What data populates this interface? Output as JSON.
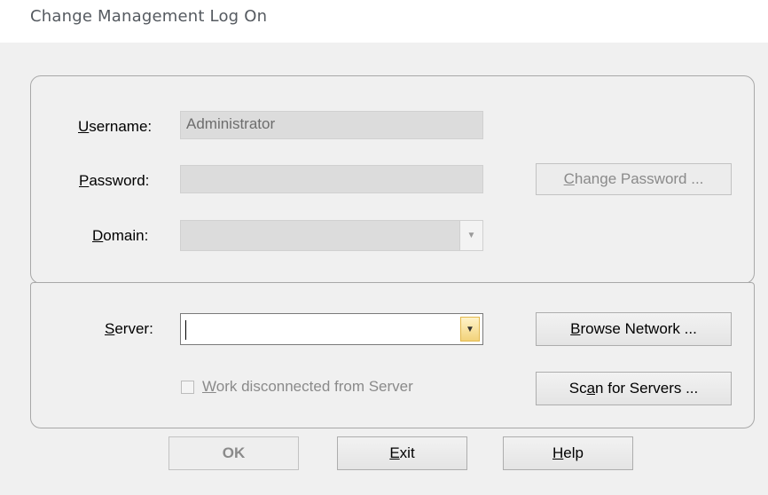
{
  "window": {
    "title": "Change Management Log On"
  },
  "login": {
    "username_label_pre": "U",
    "username_label_post": "sername:",
    "username_value": "Administrator",
    "password_label_pre": "P",
    "password_label_post": "assword:",
    "password_value": "",
    "domain_label_pre": "D",
    "domain_label_post": "omain:",
    "domain_value": "",
    "change_password_pre": "C",
    "change_password_post": "hange Password ..."
  },
  "server": {
    "label_pre": "S",
    "label_post": "erver:",
    "value": "",
    "browse_pre": "B",
    "browse_post": "rowse Network ...",
    "scan_pre": "Sc",
    "scan_u": "a",
    "scan_post": "n for Servers ...",
    "work_pre": "W",
    "work_post": "ork disconnected from Server",
    "work_checked": false
  },
  "footer": {
    "ok": "OK",
    "exit_pre": "E",
    "exit_post": "xit",
    "help_pre": "H",
    "help_post": "elp"
  },
  "colors": {
    "dialog_bg": "#f0f0f0",
    "disabled_field": "#dcdcdc",
    "dropdown_accent": "#f2d27a"
  }
}
